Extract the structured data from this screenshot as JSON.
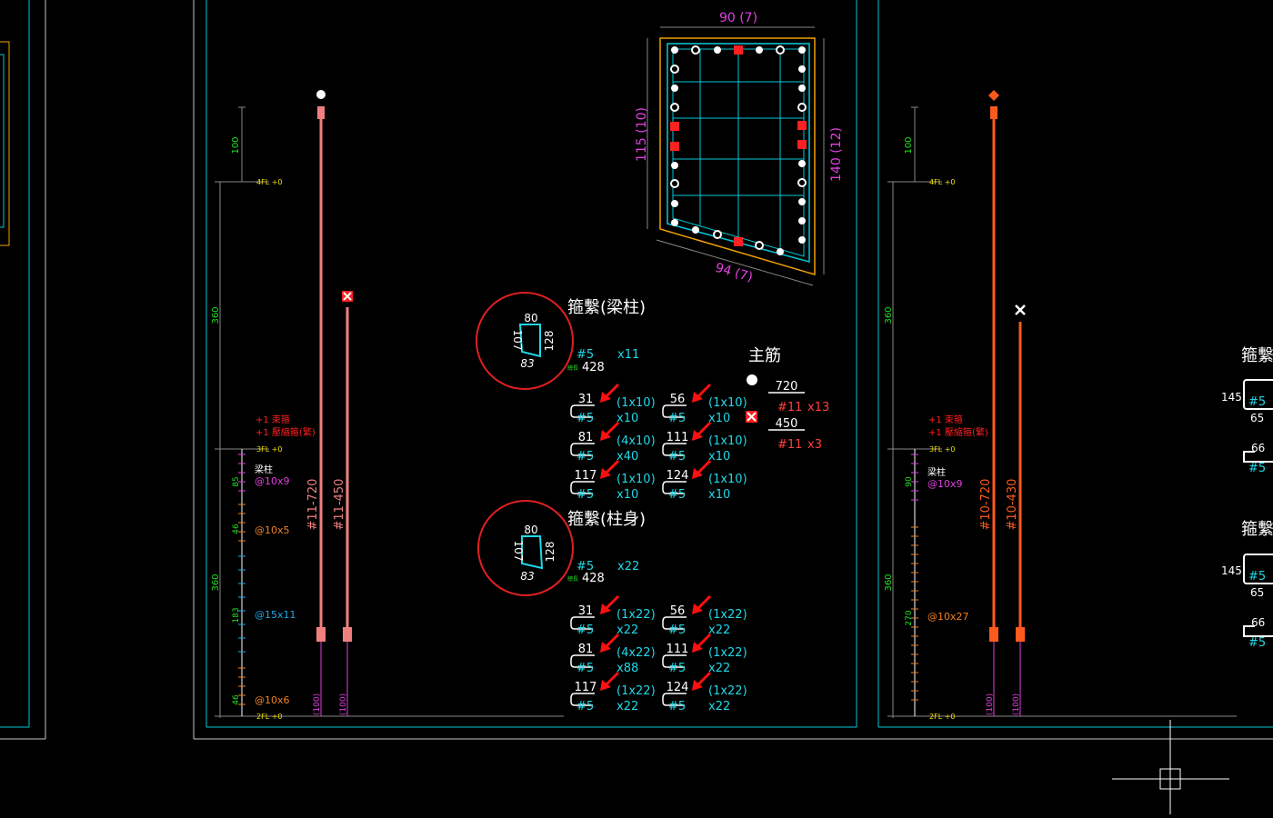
{
  "colors": {
    "background": "#000000",
    "frame_cyan": "#00c8d8",
    "frame_gray": "#c8c8c8",
    "rebar_pink": "#f08080",
    "rebar_orange": "#ff5a1e",
    "magenta": "#e040e0",
    "green": "#20e020",
    "yellow": "#f0e000",
    "cyan_text": "#20d8e8",
    "red": "#ff2020",
    "white": "#ffffff",
    "section_orange": "#f0a000"
  },
  "left_column": {
    "dim_top": "100",
    "dim_upper": "360",
    "dim_lower": "360",
    "level_4fl": "4FL +0",
    "level_3fl": "3FL +0",
    "level_2fl": "2FL +0",
    "note_1": "+1 束箍",
    "note_2": "+1 壓縮箍(繁)",
    "beam_col_label": "梁柱",
    "spacing_1": "@10x9",
    "spacing_2": "@10x5",
    "spacing_3": "@15x11",
    "spacing_4": "@10x6",
    "sub_dims": [
      "85",
      "46",
      "183",
      "46"
    ],
    "bar_label_1": "#11-720",
    "bar_label_2": "#11-450",
    "bottom_1": "(100)",
    "bottom_2": "(100)"
  },
  "section": {
    "top_dim": "90 (7)",
    "left_dim": "115 (10)",
    "right_dim": "140 (12)",
    "bottom_dim": "94 (7)"
  },
  "stirrup_beam": {
    "title": "箍繫(梁柱)",
    "dims": {
      "top": "80",
      "left": "107",
      "right": "128",
      "bottom": "83"
    },
    "bar": "#5",
    "count": "x11",
    "total_label": "總長",
    "total": "428",
    "ties": [
      {
        "len": "31",
        "bar": "#5",
        "spec": "(1x10)",
        "count": "x10"
      },
      {
        "len": "56",
        "bar": "#5",
        "spec": "(1x10)",
        "count": "x10"
      },
      {
        "len": "81",
        "bar": "#5",
        "spec": "(4x10)",
        "count": "x40"
      },
      {
        "len": "111",
        "bar": "#5",
        "spec": "(1x10)",
        "count": "x10"
      },
      {
        "len": "117",
        "bar": "#5",
        "spec": "(1x10)",
        "count": "x10"
      },
      {
        "len": "124",
        "bar": "#5",
        "spec": "(1x10)",
        "count": "x10"
      }
    ]
  },
  "stirrup_body": {
    "title": "箍繫(柱身)",
    "dims": {
      "top": "80",
      "left": "107",
      "right": "128",
      "bottom": "83"
    },
    "bar": "#5",
    "count": "x22",
    "total_label": "總長",
    "total": "428",
    "ties": [
      {
        "len": "31",
        "bar": "#5",
        "spec": "(1x22)",
        "count": "x22"
      },
      {
        "len": "56",
        "bar": "#5",
        "spec": "(1x22)",
        "count": "x22"
      },
      {
        "len": "81",
        "bar": "#5",
        "spec": "(4x22)",
        "count": "x88"
      },
      {
        "len": "111",
        "bar": "#5",
        "spec": "(1x22)",
        "count": "x22"
      },
      {
        "len": "117",
        "bar": "#5",
        "spec": "(1x22)",
        "count": "x22"
      },
      {
        "len": "124",
        "bar": "#5",
        "spec": "(1x22)",
        "count": "x22"
      }
    ]
  },
  "main_bars": {
    "title": "主筋",
    "rows": [
      {
        "len": "720",
        "bar": "#11",
        "count": "x13"
      },
      {
        "len": "450",
        "bar": "#11",
        "count": "x3"
      }
    ]
  },
  "right_column": {
    "dim_top": "100",
    "dim_upper": "360",
    "dim_lower": "360",
    "level_4fl": "4FL +0",
    "level_3fl": "3FL +0",
    "level_2fl": "2FL +0",
    "note_1": "+1 束箍",
    "note_2": "+1 壓縮箍(繁)",
    "beam_col_label": "梁柱",
    "spacing_1": "@10x9",
    "spacing_2": "@10x27",
    "sub_dims": [
      "90",
      "270"
    ],
    "bar_label_1": "#10-720",
    "bar_label_2": "#10-430",
    "bottom_1": "(100)",
    "bottom_2": "(100)"
  },
  "right_edge": {
    "title_1": "箍繫",
    "title_2": "箍繫",
    "dim_a": "145",
    "dim_b": "65",
    "dim_c": "66",
    "dim_d": "145",
    "dim_e": "65",
    "dim_f": "66",
    "bar": "#5"
  }
}
